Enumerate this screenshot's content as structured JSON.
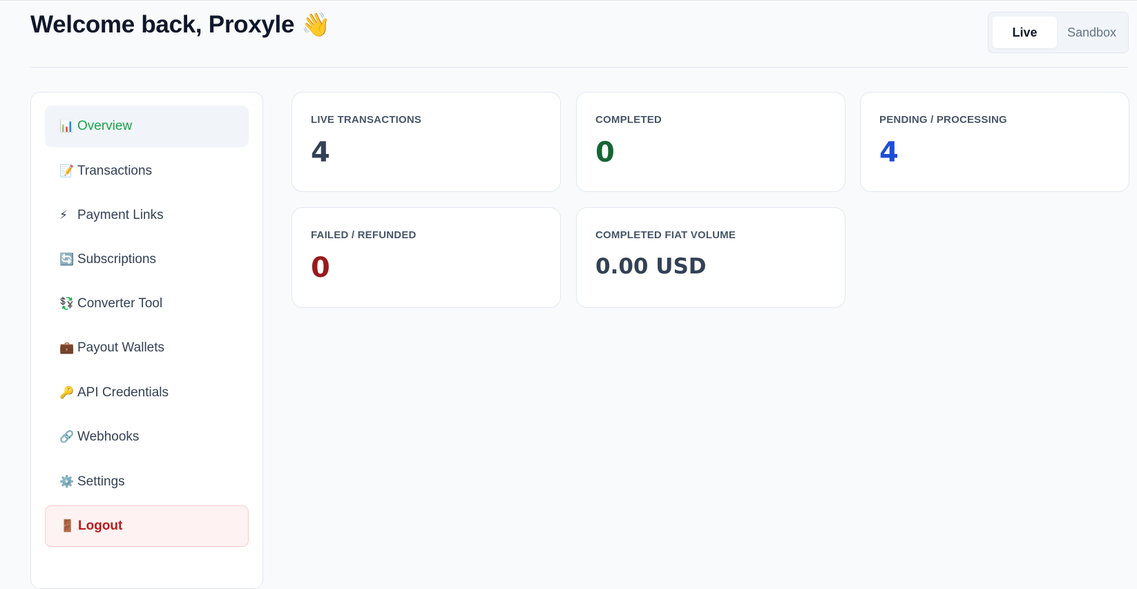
{
  "header": {
    "title": "Welcome back, Proxyle",
    "wave_emoji": "👋"
  },
  "env_toggle": {
    "options": [
      {
        "label": "Live",
        "active": true
      },
      {
        "label": "Sandbox",
        "active": false
      }
    ]
  },
  "sidebar": {
    "items": [
      {
        "icon": "📊",
        "icon_name": "chart-icon",
        "label": "Overview",
        "active": true
      },
      {
        "icon": "📝",
        "icon_name": "memo-icon",
        "label": "Transactions"
      },
      {
        "icon": "⚡",
        "icon_name": "lightning-icon",
        "label": "Payment Links"
      },
      {
        "icon": "🔄",
        "icon_name": "refresh-icon",
        "label": "Subscriptions"
      },
      {
        "icon": "💱",
        "icon_name": "currency-exchange-icon",
        "label": "Converter Tool"
      },
      {
        "icon": "💼",
        "icon_name": "briefcase-icon",
        "label": "Payout Wallets"
      },
      {
        "icon": "🔑",
        "icon_name": "key-icon",
        "label": "API Credentials"
      },
      {
        "icon": "🔗",
        "icon_name": "link-icon",
        "label": "Webhooks"
      },
      {
        "icon": "⚙️",
        "icon_name": "gear-icon",
        "label": "Settings"
      },
      {
        "icon": "🚪",
        "icon_name": "door-icon",
        "label": "Logout"
      }
    ]
  },
  "stats": {
    "live_transactions": {
      "label": "LIVE TRANSACTIONS",
      "value": "4"
    },
    "completed": {
      "label": "COMPLETED",
      "value": "0"
    },
    "pending": {
      "label": "PENDING / PROCESSING",
      "value": "4"
    },
    "failed": {
      "label": "FAILED / REFUNDED",
      "value": "0"
    },
    "fiat_volume": {
      "label": "COMPLETED FIAT VOLUME",
      "value": "0.00 USD"
    }
  },
  "colors": {
    "accent_green": "#16a34a",
    "completed_green": "#166534",
    "pending_blue": "#1d4ed8",
    "failed_red": "#991b1b",
    "logout_red": "#b91c1c"
  }
}
